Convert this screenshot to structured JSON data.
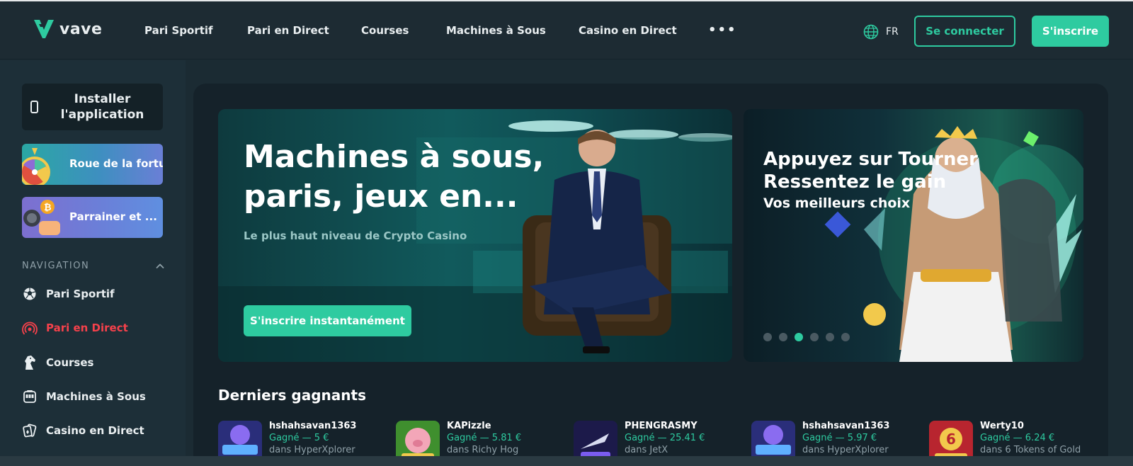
{
  "header": {
    "brand": "vave",
    "nav": [
      "Pari Sportif",
      "Pari en Direct",
      "Courses",
      "Machines à Sous",
      "Casino en Direct"
    ],
    "more": "•••",
    "language": "FR",
    "login_label": "Se connecter",
    "register_label": "S'inscrire"
  },
  "sidebar": {
    "install_label": "Installer l'application",
    "promos": [
      {
        "label": "Roue de la fortun"
      },
      {
        "label": "Parrainer et ..."
      }
    ],
    "section_label": "NAVIGATION",
    "items": [
      {
        "label": "Pari Sportif",
        "icon": "soccer-ball-icon"
      },
      {
        "label": "Pari en Direct",
        "icon": "live-broadcast-icon",
        "active": true
      },
      {
        "label": "Courses",
        "icon": "horse-icon"
      },
      {
        "label": "Machines à Sous",
        "icon": "slot-machine-icon"
      },
      {
        "label": "Casino en Direct",
        "icon": "cards-icon"
      }
    ]
  },
  "hero": {
    "title": "Machines à sous, paris, jeux en...",
    "subtitle": "Le plus haut niveau de Crypto Casino",
    "cta": "S'inscrire instantanément"
  },
  "hero2": {
    "line1": "Appuyez sur Tourner",
    "line2": "Ressentez le gain",
    "line3": "Vos meilleurs choix",
    "active_dot": 2,
    "dot_count": 6
  },
  "winners": {
    "title": "Derniers gagnants",
    "items": [
      {
        "user": "hshahsavan1363",
        "amount": "Gagné — 5 €",
        "game": "dans HyperXplorer"
      },
      {
        "user": "KAPizzle",
        "amount": "Gagné — 5.81 €",
        "game": "dans Richy Hog"
      },
      {
        "user": "PHENGRASMY",
        "amount": "Gagné — 25.41 €",
        "game": "dans JetX"
      },
      {
        "user": "hshahsavan1363",
        "amount": "Gagné — 5.97 €",
        "game": "dans HyperXplorer"
      },
      {
        "user": "Werty10",
        "amount": "Gagné — 6.24 €",
        "game": "dans 6 Tokens of Gold"
      }
    ]
  },
  "colors": {
    "accent": "#2ecba0",
    "active": "#f5414b",
    "header": "#1d2b33",
    "panel": "#15222a"
  }
}
